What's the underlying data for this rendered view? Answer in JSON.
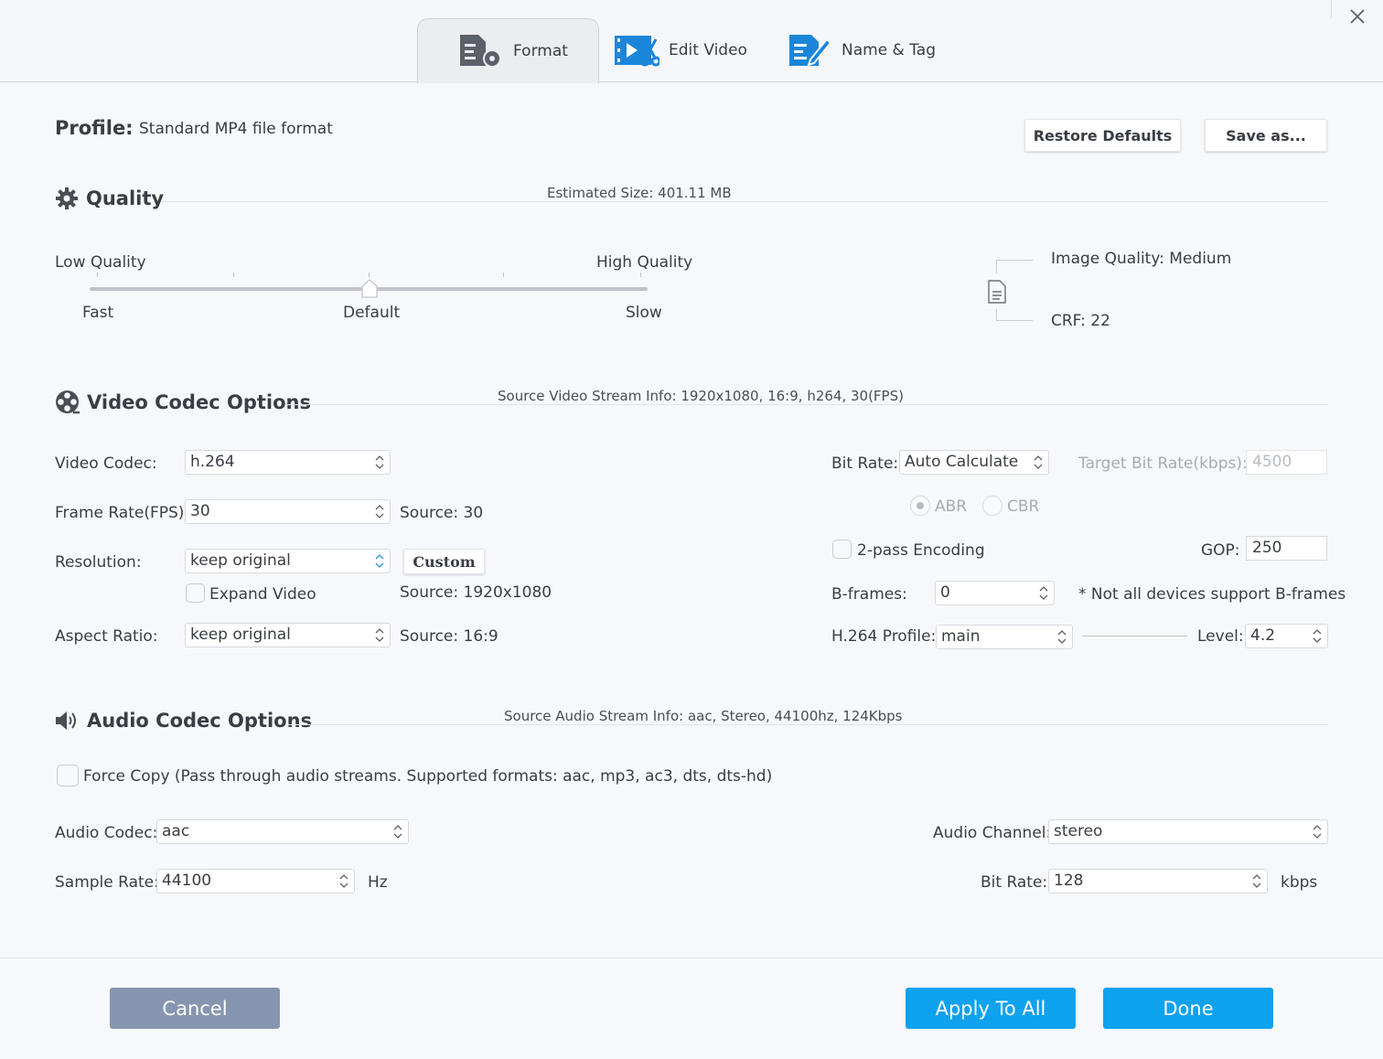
{
  "header": {
    "tabs": [
      {
        "label": "Format",
        "icon": "format-settings-icon",
        "active": true
      },
      {
        "label": "Edit Video",
        "icon": "edit-video-icon",
        "active": false
      },
      {
        "label": "Name & Tag",
        "icon": "name-tag-icon",
        "active": false
      }
    ],
    "close_icon": "close-icon"
  },
  "profile": {
    "label": "Profile:",
    "value": "Standard MP4 file format",
    "restore_defaults": "Restore Defaults",
    "save_as": "Save as..."
  },
  "quality": {
    "title": "Quality",
    "estimated_size": "Estimated Size: 401.11 MB",
    "low_label": "Low Quality",
    "high_label": "High Quality",
    "fast_label": "Fast",
    "default_label": "Default",
    "slow_label": "Slow",
    "slider_position": 0.5,
    "image_quality": "Image Quality: Medium",
    "crf": "CRF: 22"
  },
  "video": {
    "title": "Video Codec Options",
    "source_info": "Source Video Stream Info: 1920x1080, 16:9, h264, 30(FPS)",
    "codec_label": "Video Codec:",
    "codec_value": "h.264",
    "framerate_label": "Frame Rate(FPS):",
    "framerate_value": "30",
    "framerate_source": "Source: 30",
    "resolution_label": "Resolution:",
    "resolution_value": "keep original",
    "custom_button": "Custom",
    "expand_video": "Expand Video",
    "resolution_source": "Source: 1920x1080",
    "aspect_label": "Aspect Ratio:",
    "aspect_value": "keep original",
    "aspect_source": "Source: 16:9",
    "bitrate_label": "Bit Rate:",
    "bitrate_value": "Auto Calculate",
    "target_bitrate_label": "Target Bit Rate(kbps):",
    "target_bitrate_value": "4500",
    "abr_label": "ABR",
    "cbr_label": "CBR",
    "twopass_label": "2-pass Encoding",
    "gop_label": "GOP:",
    "gop_value": "250",
    "bframes_label": "B-frames:",
    "bframes_value": "0",
    "bframes_note": "* Not all devices support B-frames",
    "profile_label": "H.264 Profile:",
    "profile_value": "main",
    "level_label": "Level:",
    "level_value": "4.2"
  },
  "audio": {
    "title": "Audio Codec Options",
    "source_info": "Source Audio Stream Info: aac, Stereo, 44100hz, 124Kbps",
    "force_copy": "Force Copy (Pass through audio streams. Supported formats: aac, mp3, ac3, dts, dts-hd)",
    "codec_label": "Audio Codec:",
    "codec_value": "aac",
    "samplerate_label": "Sample Rate:",
    "samplerate_value": "44100",
    "samplerate_unit": "Hz",
    "channel_label": "Audio Channel:",
    "channel_value": "stereo",
    "bitrate_label": "Bit Rate:",
    "bitrate_value": "128",
    "bitrate_unit": "kbps"
  },
  "footer": {
    "cancel": "Cancel",
    "apply_to_all": "Apply To All",
    "done": "Done"
  },
  "colors": {
    "primary": "#0ea2ef",
    "cancel": "#8796b0"
  }
}
